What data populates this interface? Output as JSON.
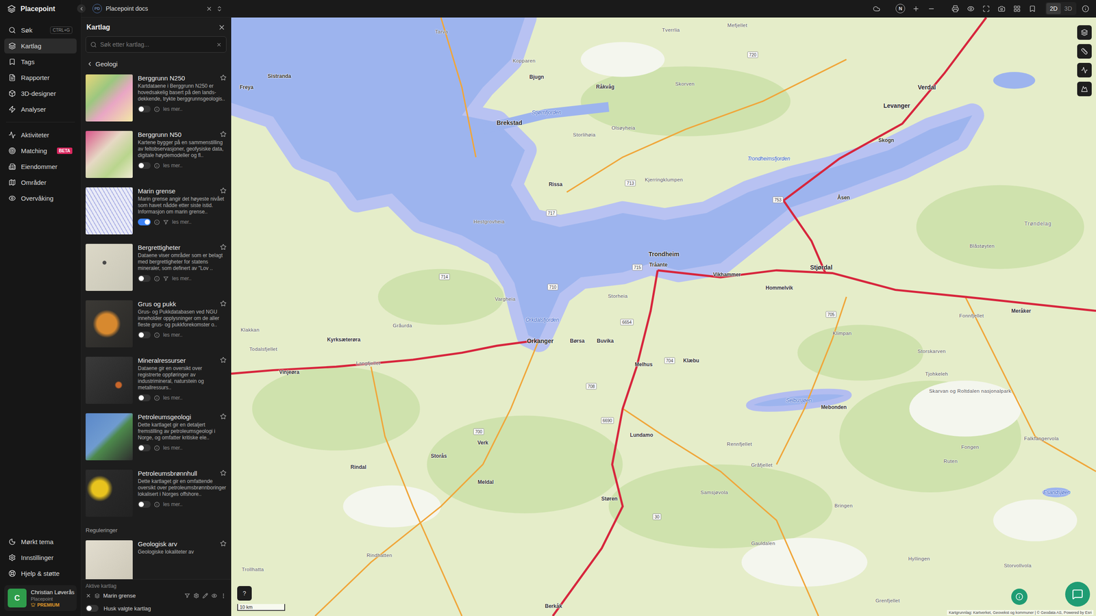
{
  "app": {
    "name": "Placepoint"
  },
  "nav": {
    "primary": [
      {
        "label": "Søk",
        "shortcut": "CTRL+G",
        "selected": false
      },
      {
        "label": "Kartlag",
        "selected": true
      },
      {
        "label": "Tags",
        "selected": false
      },
      {
        "label": "Rapporter",
        "selected": false
      },
      {
        "label": "3D-designer",
        "selected": false
      },
      {
        "label": "Analyser",
        "selected": false
      }
    ],
    "secondary": [
      {
        "label": "Aktiviteter",
        "selected": false
      },
      {
        "label": "Matching",
        "badge": "BETA",
        "selected": false
      },
      {
        "label": "Eiendommer",
        "selected": false
      },
      {
        "label": "Områder",
        "selected": false
      },
      {
        "label": "Overvåking",
        "selected": false
      }
    ],
    "footer": [
      {
        "label": "Mørkt tema"
      },
      {
        "label": "Innstillinger"
      },
      {
        "label": "Hjelp & støtte"
      }
    ],
    "user": {
      "initial": "C",
      "name": "Christian Løverås",
      "org": "Placepoint",
      "plan": "PREMIUM"
    }
  },
  "tab": {
    "badge": "PD",
    "title": "Placepoint docs"
  },
  "toolbar": {
    "compass": "N",
    "views": [
      {
        "label": "2D",
        "selected": true
      },
      {
        "label": "3D",
        "selected": false
      }
    ]
  },
  "panel": {
    "title": "Kartlag",
    "search_placeholder": "Søk etter kartlag...",
    "category": "Geologi",
    "layers": [
      {
        "title": "Berggrunn N250",
        "description": "Kartdataene i Berggrunn N250 er hovedsakelig basert på den lands-dekkende, trykte berggrunnsgeologis..",
        "on": false,
        "filter": false,
        "more": "les mer.."
      },
      {
        "title": "Berggrunn N50",
        "description": "Kartene bygger på en sammenstilling av feltobservasjoner, geofysiske data, digitale høydemodeller og fl..",
        "on": false,
        "filter": false,
        "more": "les mer.."
      },
      {
        "title": "Marin grense",
        "description": "Marin grense angir det høyeste nivået som havet nådde etter siste istid. Informasjon om marin grense..",
        "on": true,
        "filter": true,
        "more": "les mer.."
      },
      {
        "title": "Bergrettigheter",
        "description": "Dataene viser områder som er belagt med bergrettigheter for statens mineraler, som definert av \"Lov ..",
        "on": false,
        "filter": true,
        "more": "les mer.."
      },
      {
        "title": "Grus og pukk",
        "description": "Grus- og Pukkdatabasen ved NGU inneholder opplysninger om de aller fleste grus- og pukkforekomster o..",
        "on": false,
        "filter": false,
        "more": "les mer.."
      },
      {
        "title": "Mineralressurser",
        "description": "Dataene gir en oversikt over registrerte oppføringer av industrimineral, naturstein og metallressurs..",
        "on": false,
        "filter": false,
        "more": "les mer.."
      },
      {
        "title": "Petroleumsgeologi",
        "description": "Dette kartlaget gir en detaljert fremstilling av petroleumsgeologi i Norge, og omfatter kritiske ele..",
        "on": false,
        "filter": false,
        "more": "les mer.."
      },
      {
        "title": "Petroleumsbrønnhull",
        "description": "Dette kartlaget gir en omfattende oversikt over petroleumsbrønnboringer lokalisert i Norges offshore..",
        "on": false,
        "filter": false,
        "more": "les mer.."
      }
    ],
    "section": "Reguleringer",
    "section_layers": [
      {
        "title": "Geologisk arv",
        "description": "Geologiske lokaliteter av"
      }
    ],
    "active": {
      "title": "Aktive kartlag",
      "layers": [
        {
          "name": "Marin grense"
        }
      ],
      "remember": {
        "label": "Husk valgte kartlag",
        "on": false
      }
    }
  },
  "map": {
    "labels": [
      {
        "text": "Tarva",
        "kind": "place"
      },
      {
        "text": "Tverrlia",
        "kind": "place"
      },
      {
        "text": "Mefjellet",
        "kind": "place"
      },
      {
        "text": "Kopparen",
        "kind": "place"
      },
      {
        "text": "Bjugn",
        "kind": "town"
      },
      {
        "text": "Råkvåg",
        "kind": "town"
      },
      {
        "text": "Skorven",
        "kind": "place"
      },
      {
        "text": "Freya",
        "kind": "town"
      },
      {
        "text": "Sistranda",
        "kind": "town"
      },
      {
        "text": "Brekstad",
        "kind": "city"
      },
      {
        "text": "Stjørnfjorden",
        "kind": "water"
      },
      {
        "text": "Storlihøia",
        "kind": "place"
      },
      {
        "text": "Olsøyheia",
        "kind": "place"
      },
      {
        "text": "Verdal",
        "kind": "city"
      },
      {
        "text": "Levanger",
        "kind": "city"
      },
      {
        "text": "Trondheimsfjorden",
        "kind": "water"
      },
      {
        "text": "Kjerringklumpen",
        "kind": "place"
      },
      {
        "text": "Rissa",
        "kind": "town"
      },
      {
        "text": "Hestgrovheia",
        "kind": "place"
      },
      {
        "text": "Trøndelag",
        "kind": "region"
      },
      {
        "text": "Trondheim",
        "kind": "city"
      },
      {
        "text": "Tråante",
        "kind": "town"
      },
      {
        "text": "Stjørdal",
        "kind": "city"
      },
      {
        "text": "Vikhammer",
        "kind": "town"
      },
      {
        "text": "Storheia",
        "kind": "place"
      },
      {
        "text": "Vargheia",
        "kind": "place"
      },
      {
        "text": "Hommelvik",
        "kind": "town"
      },
      {
        "text": "Orkdalsfjorden",
        "kind": "water"
      },
      {
        "text": "Gråurda",
        "kind": "place"
      },
      {
        "text": "Kyrksæterøra",
        "kind": "town"
      },
      {
        "text": "Orkanger",
        "kind": "city"
      },
      {
        "text": "Børsa",
        "kind": "town"
      },
      {
        "text": "Buvika",
        "kind": "town"
      },
      {
        "text": "Melhus",
        "kind": "town"
      },
      {
        "text": "Klæbu",
        "kind": "town"
      },
      {
        "text": "Todalsfjellet",
        "kind": "place"
      },
      {
        "text": "Vinjeøra",
        "kind": "town"
      },
      {
        "text": "Langfjellet",
        "kind": "place"
      },
      {
        "text": "Selbusjøen",
        "kind": "water"
      },
      {
        "text": "Mebonden",
        "kind": "town"
      },
      {
        "text": "Skarvan og Roltdalen nasjonalpark",
        "kind": "place"
      },
      {
        "text": "Storskarven",
        "kind": "place"
      },
      {
        "text": "Tjohkeleh",
        "kind": "place"
      },
      {
        "text": "Meråker",
        "kind": "town"
      },
      {
        "text": "Fonnfjellet",
        "kind": "place"
      },
      {
        "text": "Klimpan",
        "kind": "place"
      },
      {
        "text": "Støren",
        "kind": "town"
      },
      {
        "text": "Lundamo",
        "kind": "town"
      },
      {
        "text": "Rennfjellet",
        "kind": "place"
      },
      {
        "text": "Gråfjellet",
        "kind": "place"
      },
      {
        "text": "Meldal",
        "kind": "town"
      },
      {
        "text": "Verk",
        "kind": "town"
      },
      {
        "text": "Storås",
        "kind": "town"
      },
      {
        "text": "Rindal",
        "kind": "town"
      },
      {
        "text": "Rindhatten",
        "kind": "place"
      },
      {
        "text": "Hyllingen",
        "kind": "place"
      },
      {
        "text": "Gauldalen",
        "kind": "place"
      },
      {
        "text": "Samsjøvola",
        "kind": "place"
      },
      {
        "text": "Bringen",
        "kind": "place"
      },
      {
        "text": "Fongen",
        "kind": "place"
      },
      {
        "text": "Ruten",
        "kind": "place"
      },
      {
        "text": "Falkfangervola",
        "kind": "place"
      },
      {
        "text": "Esandsjøen",
        "kind": "water"
      },
      {
        "text": "Storvollvola",
        "kind": "place"
      },
      {
        "text": "Grenfjellet",
        "kind": "place"
      },
      {
        "text": "Berkåk",
        "kind": "town"
      },
      {
        "text": "Trollhatta",
        "kind": "place"
      },
      {
        "text": "Skogn",
        "kind": "town"
      },
      {
        "text": "Åsen",
        "kind": "town"
      },
      {
        "text": "Blåstøyten",
        "kind": "place"
      },
      {
        "text": "Klakkan",
        "kind": "place"
      }
    ],
    "shields": [
      "714",
      "715",
      "705",
      "710",
      "704",
      "6654",
      "30",
      "700",
      "717",
      "713",
      "753",
      "720",
      "708",
      "6690"
    ],
    "scale": "10 km",
    "help": "?",
    "attribution": "Kartgrunnlag: Kartverket, Geovekst og kommuner | © Geodata AS, Powered by Esri"
  }
}
